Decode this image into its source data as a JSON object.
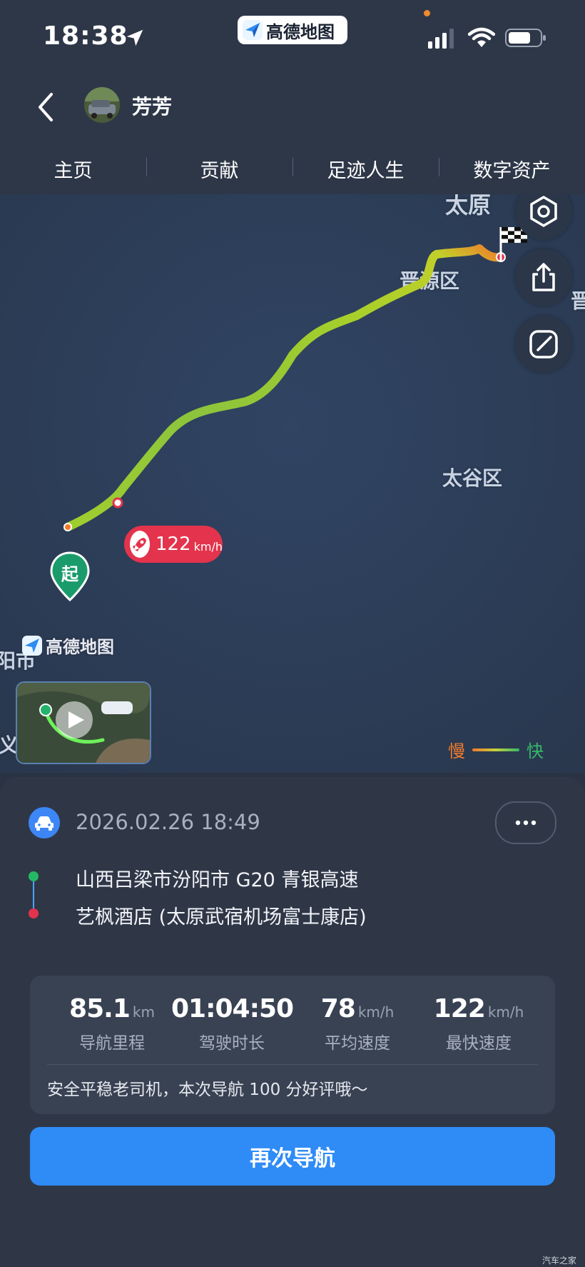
{
  "status_bar": {
    "time": "18:38",
    "app_pill": "高德地图"
  },
  "header": {
    "back_icon": "chevron-left-icon",
    "user_name": "芳芳"
  },
  "tabs": [
    {
      "label": "主页"
    },
    {
      "label": "贡献"
    },
    {
      "label": "足迹人生"
    },
    {
      "label": "数字资产"
    }
  ],
  "map": {
    "labels": {
      "taiyuan": "太原",
      "jinyuan": "晋源区",
      "taigu": "太谷区",
      "fenyang": "阳市",
      "jin": "晋",
      "xiaoyi": "义"
    },
    "speed_tag": {
      "value": "122",
      "unit": "km/h"
    },
    "start_pin": "起",
    "watermark": "高德地图",
    "legend": {
      "slow": "慢",
      "fast": "快"
    },
    "side_buttons": [
      "settings-icon",
      "share-icon",
      "edit-icon"
    ]
  },
  "trip": {
    "datetime": "2026.02.26 18:49",
    "origin": "山西吕梁市汾阳市 G20 青银高速",
    "destination": "艺枫酒店 (太原武宿机场富士康店)",
    "stats": [
      {
        "value": "85.1",
        "unit": "km",
        "label": "导航里程"
      },
      {
        "value": "01:04:50",
        "unit": "",
        "label": "驾驶时长"
      },
      {
        "value": "78",
        "unit": "km/h",
        "label": "平均速度"
      },
      {
        "value": "122",
        "unit": "km/h",
        "label": "最快速度"
      }
    ],
    "praise": "安全平稳老司机，本次导航 100 分好评哦～",
    "renav_button": "再次导航"
  },
  "footer_watermark": "汽车之家",
  "colors": {
    "accent": "#2f8bf6",
    "speed_tag": "#e4334c",
    "route_start": "#f27a2a",
    "route_mid": "#c5d23c",
    "route_end": "#35b96a"
  }
}
